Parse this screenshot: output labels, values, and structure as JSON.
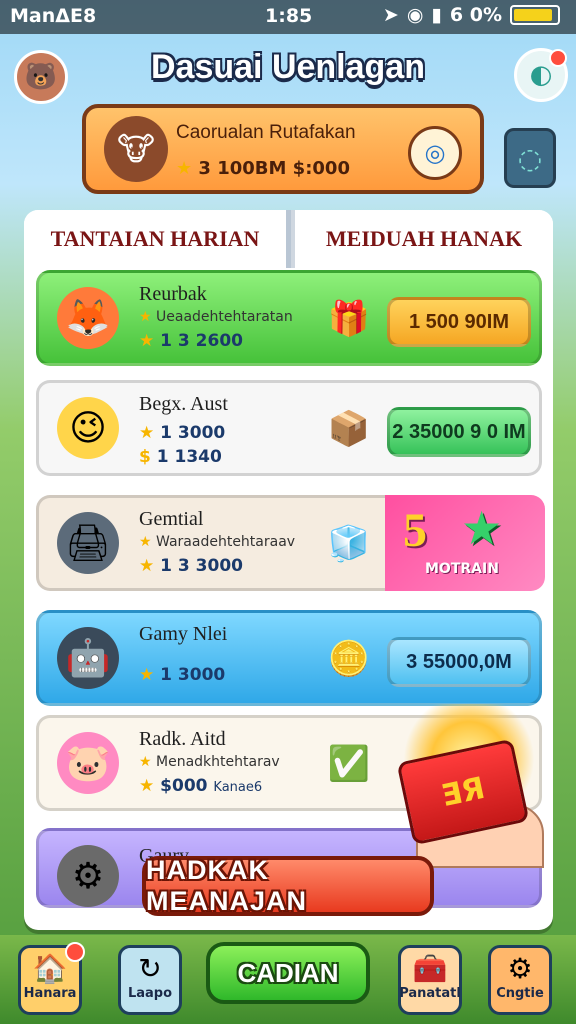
{
  "status_bar": {
    "carrier": "ManΔE8",
    "time": "1:85",
    "battery_text": "6 0%",
    "battery_level": 0.9
  },
  "header": {
    "title": "Dasuai Uenlagan"
  },
  "banner": {
    "title": "Caorualan Rutafakan",
    "subtitle_value": "3 100BM $:000"
  },
  "tabs": [
    {
      "label": "TANTAIAN HARIAN"
    },
    {
      "label": "MEIDUAH HANAK"
    }
  ],
  "quests": [
    {
      "title": "Reurbak",
      "desc": "Ueaadehtehtaratan",
      "value": "1 3 2600",
      "button": "1 500 90IM"
    },
    {
      "title": "Begx. Aust",
      "value_a": "1 3000",
      "value_b": "1 1340",
      "button": "2 35000 9 0 IM"
    },
    {
      "title": "Gemtial",
      "desc": "Waraadehtehtaraav",
      "value": "1 3 3000",
      "bonus_number": "5",
      "bonus_label": "MOTRAIN"
    },
    {
      "title": "Gamy Nlei",
      "value": "1 3000",
      "button": "3 55000,0M"
    },
    {
      "title": "Radk. Aitd",
      "desc": "Menadkhtehtarav",
      "value": "$000",
      "value_suffix": "Kanae6"
    },
    {
      "title": "Gaury..."
    }
  ],
  "gift_label": "ƎЯ",
  "cta_label": "HADKAK MEANAJAN",
  "nav": [
    {
      "label": "Hanara",
      "icon": "home-icon"
    },
    {
      "label": "Laapo",
      "icon": "refresh-icon"
    },
    {
      "label": "CADIAN",
      "icon": "none"
    },
    {
      "label": "Panatatl",
      "icon": "chest-icon"
    },
    {
      "label": "Cngtie",
      "icon": "gear-icon"
    }
  ],
  "colors": {
    "accent_orange": "#ff9a3c",
    "accent_green": "#46c23a",
    "accent_blue": "#2fa8e8",
    "cta_red": "#e83a1f",
    "tab_text": "#7a1515"
  }
}
